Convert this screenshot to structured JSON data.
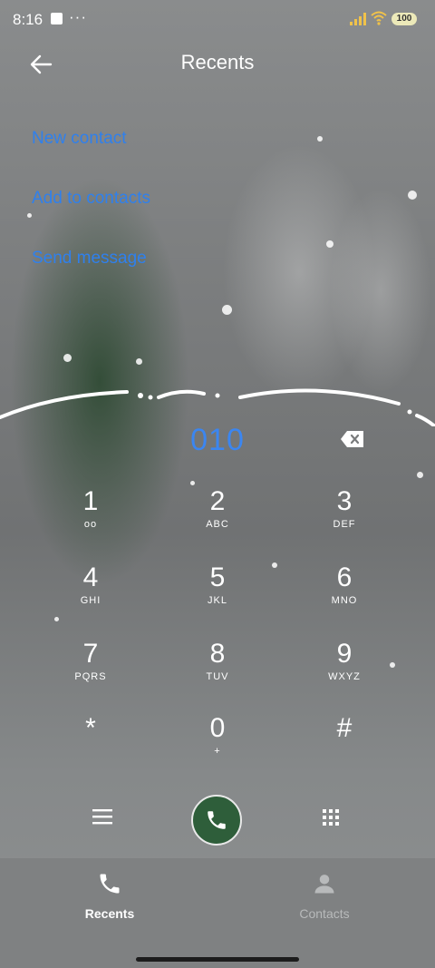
{
  "status_bar": {
    "time": "8:16",
    "extra": "···",
    "battery": "100"
  },
  "header": {
    "title": "Recents"
  },
  "actions": {
    "new_contact": "New contact",
    "add_to_contacts": "Add to contacts",
    "send_message": "Send message"
  },
  "dialer": {
    "number": "010",
    "keys": [
      {
        "digit": "1",
        "letters": "oo"
      },
      {
        "digit": "2",
        "letters": "ABC"
      },
      {
        "digit": "3",
        "letters": "DEF"
      },
      {
        "digit": "4",
        "letters": "GHI"
      },
      {
        "digit": "5",
        "letters": "JKL"
      },
      {
        "digit": "6",
        "letters": "MNO"
      },
      {
        "digit": "7",
        "letters": "PQRS"
      },
      {
        "digit": "8",
        "letters": "TUV"
      },
      {
        "digit": "9",
        "letters": "WXYZ"
      },
      {
        "digit": "*",
        "letters": ""
      },
      {
        "digit": "0",
        "letters": "+"
      },
      {
        "digit": "#",
        "letters": ""
      }
    ]
  },
  "bottom_nav": {
    "recents": "Recents",
    "contacts": "Contacts"
  },
  "colors": {
    "link": "#2f80ed",
    "number": "#3b86f1",
    "call": "#2e5e3a"
  }
}
